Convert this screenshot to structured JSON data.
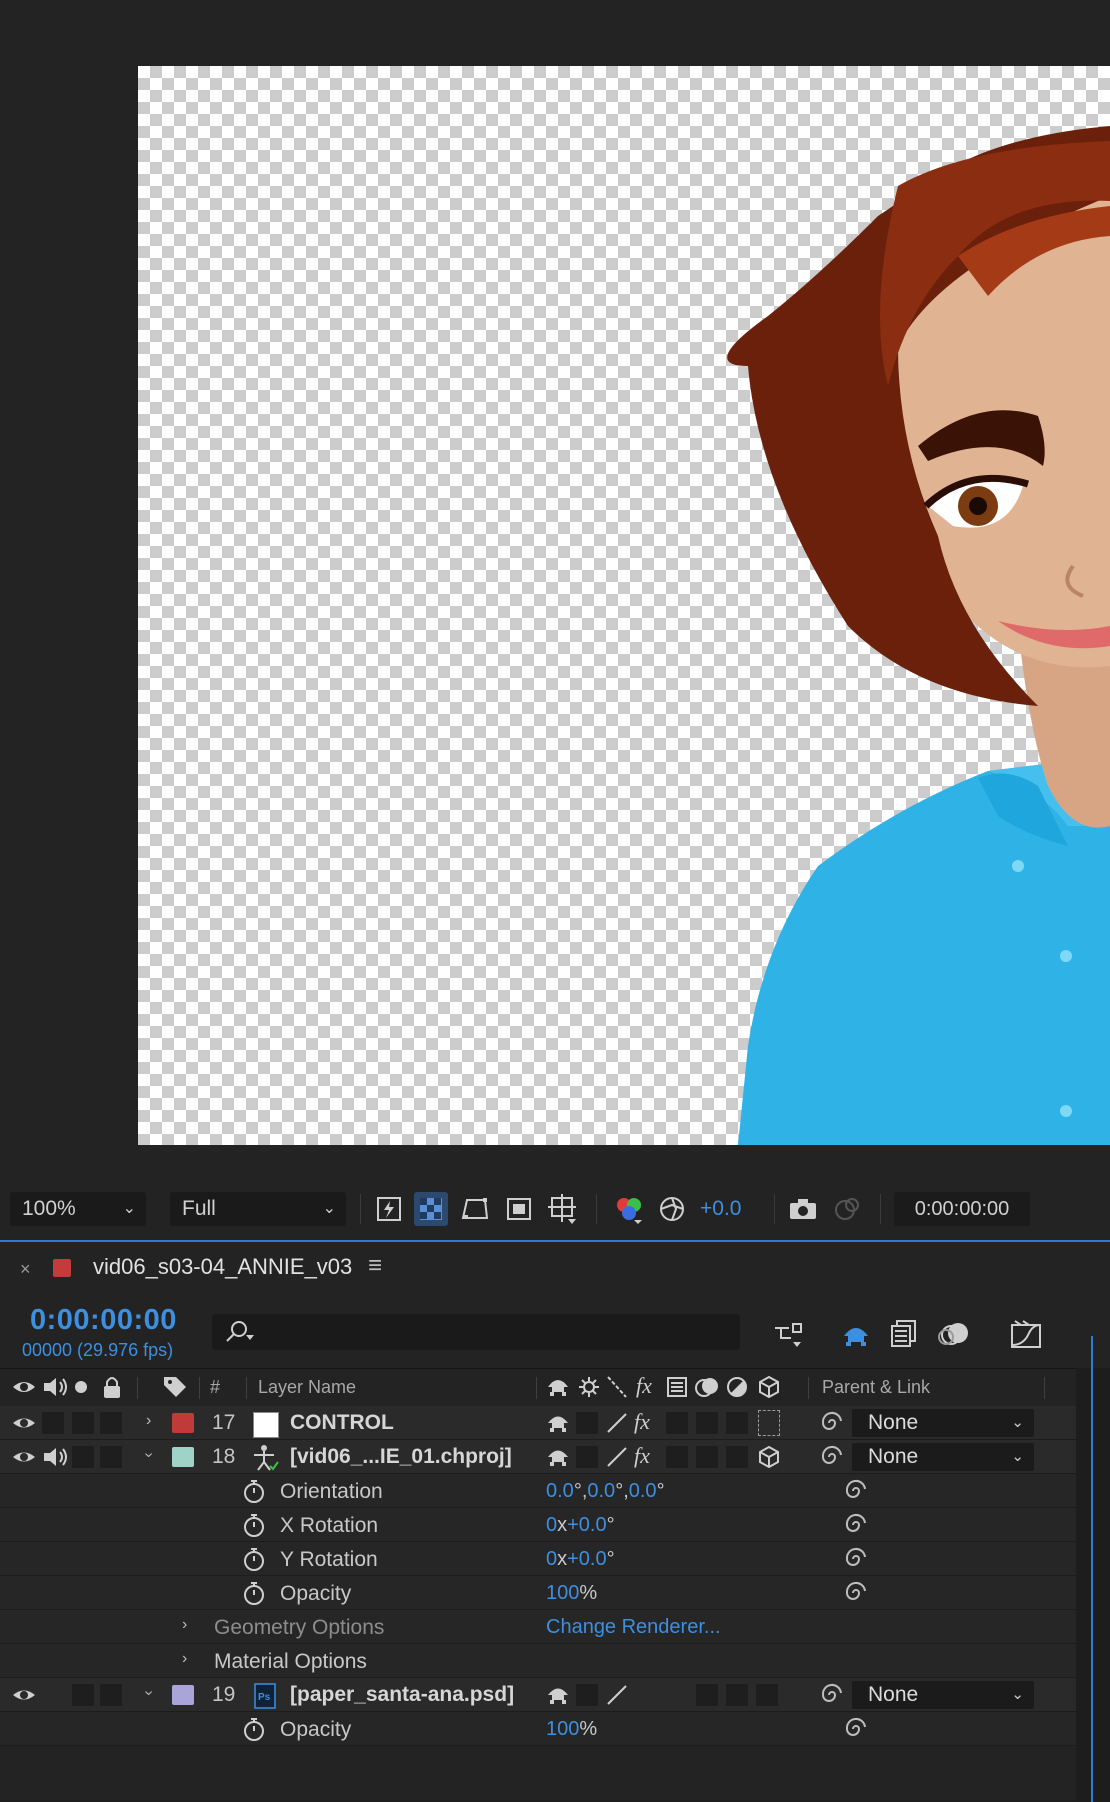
{
  "viewer": {
    "zoom": "100%",
    "resolution": "Full",
    "exposure": "+0.0",
    "timecode": "0:00:00:00"
  },
  "composition": {
    "name": "vid06_s03-04_ANNIE_v03",
    "tab_color": "#c33b3b",
    "current_time": "0:00:00:00",
    "frame_info": "00000 (29.976 fps)",
    "search_placeholder": ""
  },
  "columns": {
    "number": "#",
    "layer_name": "Layer Name",
    "parent_link": "Parent & Link"
  },
  "layers": [
    {
      "num": "17",
      "name": "CONTROL",
      "label_color": "#c03a3a",
      "parent": "None",
      "expanded": false
    },
    {
      "num": "18",
      "name": "[vid06_...IE_01.chproj]",
      "label_color": "#9fd3c7",
      "parent": "None",
      "expanded": true
    },
    {
      "num": "19",
      "name": "[paper_santa-ana.psd]",
      "label_color": "#a9a5d8",
      "parent": "None",
      "expanded": true
    }
  ],
  "properties": {
    "orientation": {
      "label": "Orientation",
      "v1": "0.0",
      "v2": "0.0",
      "v3": "0.0",
      "unit": "°"
    },
    "x_rotation": {
      "label": "X Rotation",
      "rev": "0",
      "mid": "x",
      "value": "+0.0",
      "unit": "°"
    },
    "y_rotation": {
      "label": "Y Rotation",
      "rev": "0",
      "mid": "x",
      "value": "+0.0",
      "unit": "°"
    },
    "opacity_18": {
      "label": "Opacity",
      "value": "100",
      "unit": "%"
    },
    "geometry_options": {
      "label": "Geometry Options",
      "action": "Change Renderer..."
    },
    "material_options": {
      "label": "Material Options"
    },
    "opacity_19": {
      "label": "Opacity",
      "value": "100",
      "unit": "%"
    }
  },
  "colors": {
    "accent_blue": "#3d8fe0",
    "panel_bg": "#232323",
    "shirt": "#2fb3e6",
    "hair": "#6b200c"
  }
}
